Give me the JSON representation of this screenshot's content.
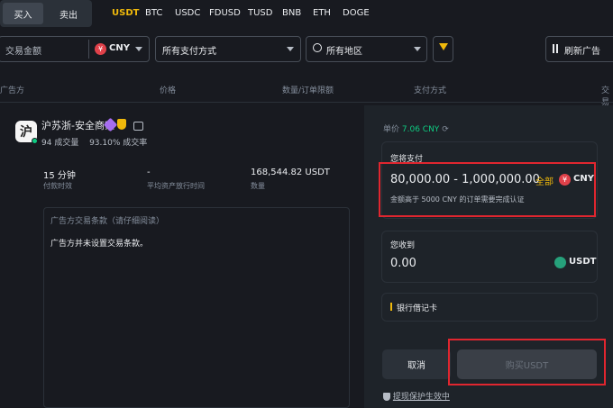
{
  "tabs": {
    "buy": "买入",
    "sell": "卖出"
  },
  "coins": [
    "USDT",
    "BTC",
    "USDC",
    "FDUSD",
    "TUSD",
    "BNB",
    "ETH",
    "DOGE"
  ],
  "active_coin": "USDT",
  "filters": {
    "amount_placeholder": "交易金额",
    "currency_symbol": "¥",
    "currency": "CNY",
    "payment": "所有支付方式",
    "region": "所有地区",
    "refresh": "刷新广告"
  },
  "columns": [
    "广告方",
    "价格",
    "数量/订单限额",
    "支付方式",
    "交易"
  ],
  "merchant": {
    "avatar_char": "沪",
    "name": "沪苏浙-安全商家",
    "orders": "94 成交量",
    "completion": "93.10% 成交率",
    "metrics": [
      {
        "value": "15 分钟",
        "label": "付款时效"
      },
      {
        "value": "-",
        "label": "平均资产放行时间"
      },
      {
        "value": "168,544.82 USDT",
        "label": "数量"
      }
    ],
    "terms_title": "广告方交易条款（请仔细阅读）",
    "terms_text": "广告方并未设置交易条款。"
  },
  "order": {
    "price_label": "单价",
    "price_value": "7.06 CNY",
    "pay_label": "您将支付",
    "pay_range": "80,000.00 - 1,000,000.00",
    "all_label": "全部",
    "pay_currency": "CNY",
    "pay_hint": "金额高于 5000 CNY 的订单需要完成认证",
    "receive_label": "您收到",
    "receive_value": "0.00",
    "receive_currency": "USDT",
    "payment_method": "银行借记卡",
    "cancel": "取消",
    "buy": "购买USDT",
    "protection": "提现保护生效中"
  },
  "colors": {
    "accent": "#f0b90b",
    "positive": "#0ecb81",
    "highlight_box": "#e0262f"
  }
}
